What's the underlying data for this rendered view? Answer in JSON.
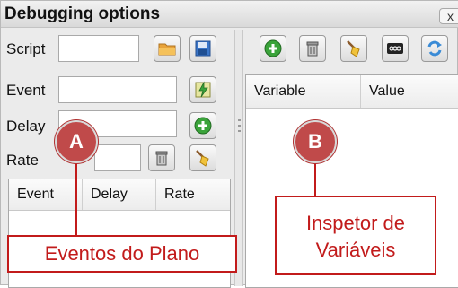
{
  "window": {
    "title": "Debugging options",
    "close_label": "x"
  },
  "left_panel": {
    "script_label": "Script",
    "event_label": "Event",
    "delay_label": "Delay",
    "rate_label": "Rate",
    "events_table": {
      "columns": [
        "Event",
        "Delay",
        "Rate"
      ]
    }
  },
  "right_panel": {
    "variables_table": {
      "columns": [
        "Variable",
        "Value"
      ]
    }
  },
  "annotations": {
    "a_marker": "A",
    "b_marker": "B",
    "a_caption": "Eventos do Plano",
    "b_caption_line1": "Inspetor de",
    "b_caption_line2": "Variáveis"
  },
  "colors": {
    "annotation_red": "#c21b1b",
    "marker_fill": "#c04a4a",
    "add_icon_green": "#3aa33a",
    "folder_orange": "#e8a33a",
    "save_blue": "#3a76c9"
  }
}
